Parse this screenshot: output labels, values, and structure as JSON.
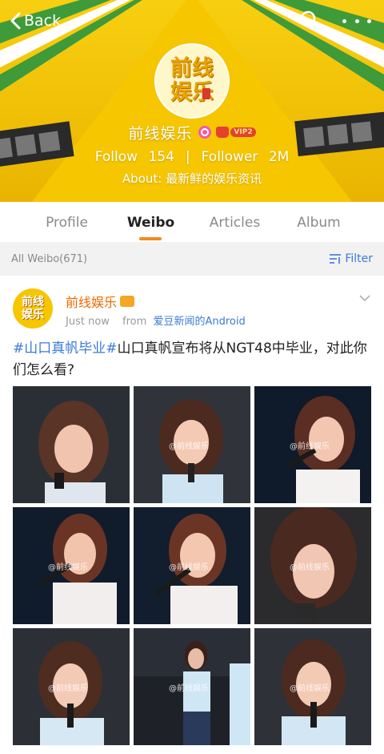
{
  "nav": {
    "back_label": "Back"
  },
  "profile": {
    "name": "前线娱乐",
    "logo_line1": "前线",
    "logo_line2": "娱乐",
    "vip_label": "VIP2",
    "follow_label": "Follow",
    "follow_count": "154",
    "separator": "|",
    "follower_label": "Follower",
    "follower_count": "2M",
    "about": "About: 最新鲜的娱乐资讯"
  },
  "tabs": [
    {
      "label": "Profile"
    },
    {
      "label": "Weibo"
    },
    {
      "label": "Articles"
    },
    {
      "label": "Album"
    }
  ],
  "filter": {
    "all_label": "All Weibo(671)",
    "filter_label": "Filter"
  },
  "post": {
    "author": "前线娱乐",
    "avatar_line1": "前线",
    "avatar_line2": "娱乐",
    "time": "Just now",
    "from_label": "from",
    "source": "爱豆新闻的Android",
    "hashtag": "#山口真帆毕业#",
    "text": "山口真帆宣布将从NGT48中毕业，对此你们怎么看?",
    "watermark": "@前线娱乐"
  },
  "colors": {
    "brand_yellow": "#f6c600",
    "accent_orange": "#f08a1c",
    "link_blue": "#3c7ad6"
  }
}
